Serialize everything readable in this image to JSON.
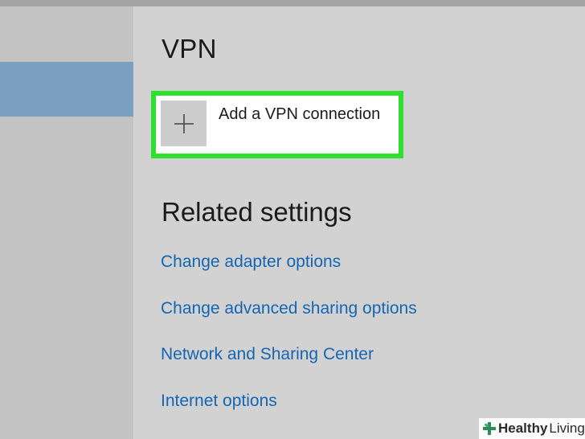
{
  "vpn": {
    "title": "VPN",
    "add_connection_label": "Add a VPN connection",
    "add_icon": "plus-icon"
  },
  "related": {
    "title": "Related settings",
    "links": [
      "Change adapter options",
      "Change advanced sharing options",
      "Network and Sharing Center",
      "Internet options"
    ]
  },
  "watermark": {
    "brand_bold": "Healthy",
    "brand_light": "Living",
    "icon": "leaf-cross-icon"
  },
  "colors": {
    "highlight_border": "#2fe02f",
    "link": "#1466b3",
    "sidebar_selected": "#7a9fc0"
  }
}
